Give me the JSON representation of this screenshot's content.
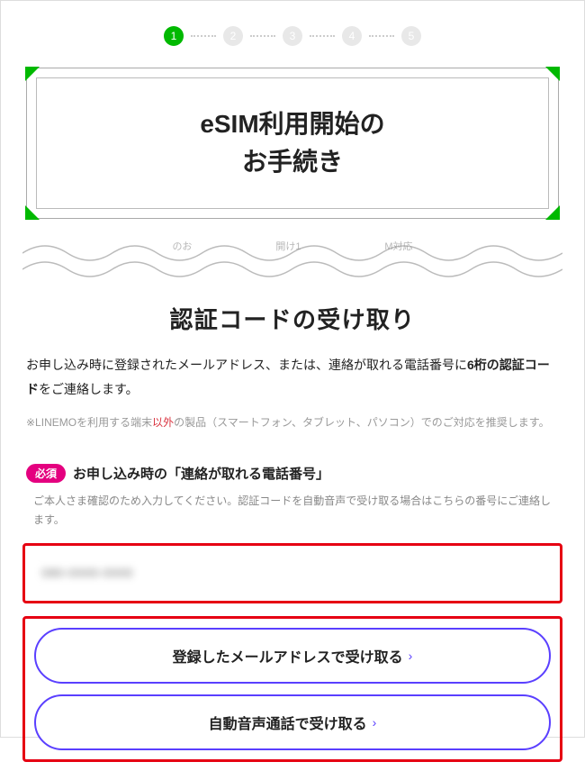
{
  "stepper": {
    "steps": [
      "1",
      "2",
      "3",
      "4",
      "5"
    ],
    "active_index": 0
  },
  "title": {
    "line1": "eSIM利用開始の",
    "line2": "お手続き"
  },
  "partial_strip": {
    "a": "のお",
    "b": "開け1",
    "c": "M対応"
  },
  "section_heading": "認証コードの受け取り",
  "intro": {
    "part1": "お申し込み時に登録されたメールアドレス、または、連絡が取れる電話番号に",
    "bold": "6桁の認証コード",
    "part2": "をご連絡します。"
  },
  "note": {
    "pre": "※LINEMOを利用する端末",
    "red": "以外",
    "post": "の製品（スマートフォン、タブレット、パソコン）でのご対応を推奨します。"
  },
  "field": {
    "required_badge": "必須",
    "label": "お申し込み時の「連絡が取れる電話番号」",
    "help": "ご本人さま確認のため入力してください。認証コードを自動音声で受け取る場合はこちらの番号にご連絡します。",
    "input_value": "080-0000-0000"
  },
  "buttons": {
    "email": "登録したメールアドレスで受け取る",
    "voice": "自動音声通話で受け取る",
    "chevron": "›"
  }
}
